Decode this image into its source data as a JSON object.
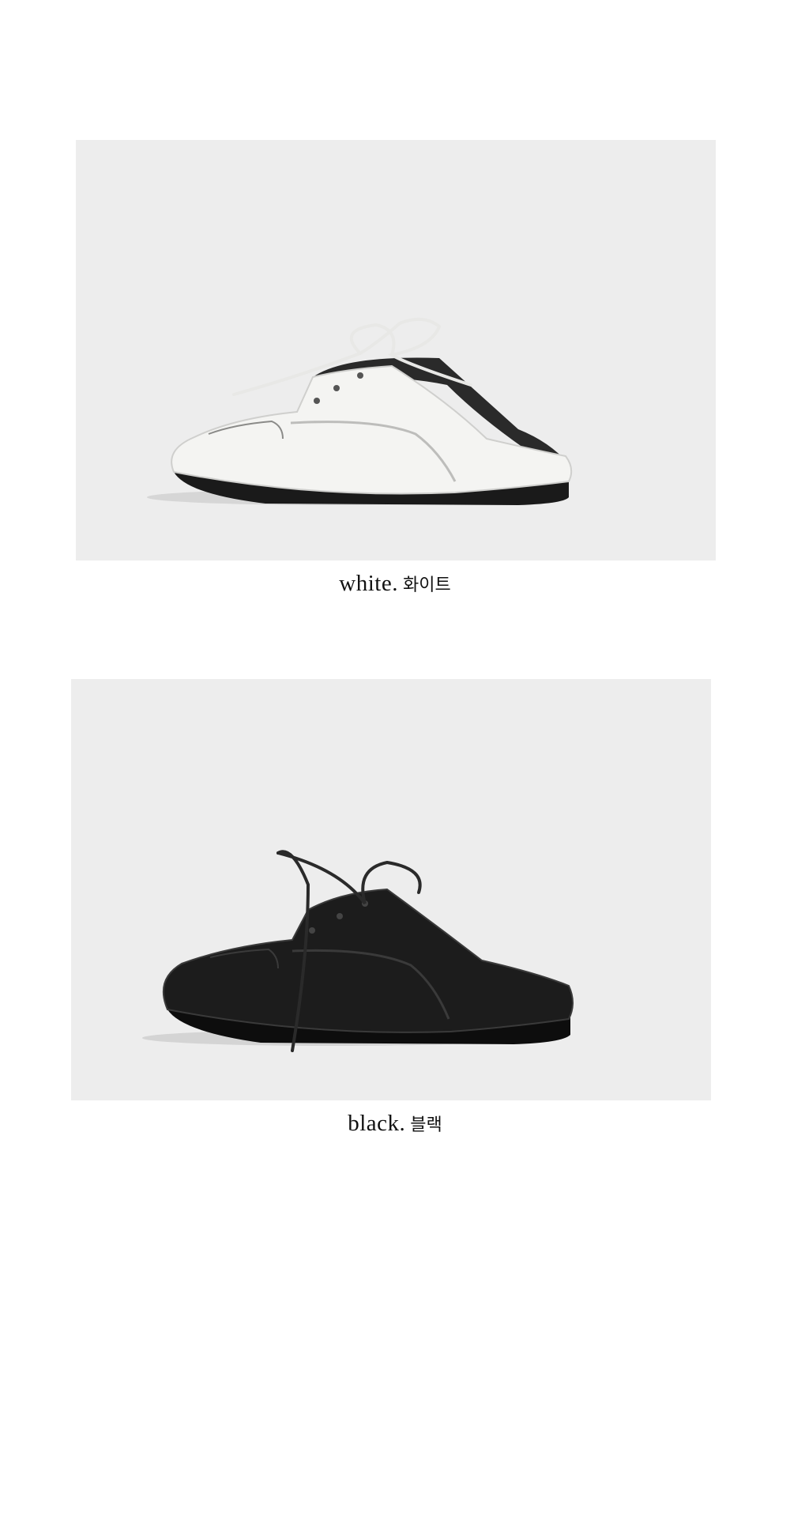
{
  "products": [
    {
      "color_name_en": "white.",
      "color_name_ko": "화이트",
      "shoe_color": "#f4f4f2",
      "lining_color": "#2a2a2a",
      "sole_color": "#1a1a1a",
      "lace_color": "#e8e8e6"
    },
    {
      "color_name_en": "black.",
      "color_name_ko": "블랙",
      "shoe_color": "#1c1c1c",
      "lining_color": "#6a6a6a",
      "sole_color": "#0d0d0d",
      "lace_color": "#2a2a2a"
    }
  ],
  "background_color": "#ededed"
}
